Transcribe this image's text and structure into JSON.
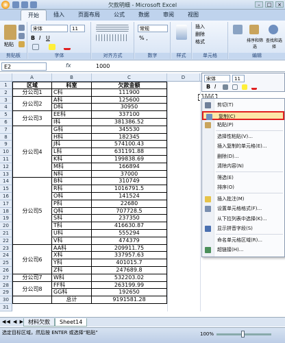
{
  "window": {
    "title": "欠款明细 - Microsoft Excel"
  },
  "ribbon": {
    "tabs": [
      "开始",
      "插入",
      "页面布局",
      "公式",
      "数据",
      "审阅",
      "视图"
    ],
    "active_tab": "开始",
    "groups": [
      "剪贴板",
      "字体",
      "对齐方式",
      "数字",
      "样式",
      "单元格",
      "编辑"
    ],
    "paste_label": "粘贴",
    "font_name": "宋体",
    "font_size": "11",
    "number_format": "常规",
    "percent_label": "% ,",
    "cells_buttons": [
      "插入",
      "删除",
      "格式"
    ],
    "edit_buttons": [
      "排序和筛选",
      "查找和选择"
    ]
  },
  "formula_bar": {
    "name_box": "E2",
    "fx": "fx",
    "value": "1000"
  },
  "columns": [
    "A",
    "B",
    "C",
    "D",
    "E"
  ],
  "table": {
    "headers": [
      "区域",
      "科室",
      "欠款金额"
    ],
    "groups": [
      {
        "region": "分公司1",
        "rows": [
          [
            "C科",
            "111900"
          ]
        ]
      },
      {
        "region": "分公司2",
        "rows": [
          [
            "A科",
            "125600"
          ],
          [
            "D科",
            "30950"
          ]
        ]
      },
      {
        "region": "分公司3",
        "rows": [
          [
            "EE科",
            "337100"
          ],
          [
            "I科",
            "381386.52"
          ]
        ]
      },
      {
        "region": "分公司4",
        "rows": [
          [
            "G科",
            "345530"
          ],
          [
            "H科",
            "182345"
          ],
          [
            "J科",
            "574100.43"
          ],
          [
            "L科",
            "631191.88"
          ],
          [
            "K科",
            "199838.69"
          ],
          [
            "M科",
            "166894"
          ],
          [
            "N科",
            "37000"
          ]
        ]
      },
      {
        "region": "分公司5",
        "rows": [
          [
            "B科",
            "310749"
          ],
          [
            "R科",
            "1016791.5"
          ],
          [
            "O科",
            "141524"
          ],
          [
            "P科",
            "22680"
          ],
          [
            "Q科",
            "707728.5"
          ],
          [
            "S科",
            "237350"
          ],
          [
            "T科",
            "416630.87"
          ],
          [
            "U科",
            "555294"
          ],
          [
            "V科",
            "474379"
          ]
        ]
      },
      {
        "region": "分公司6",
        "rows": [
          [
            "AA科",
            "209911.75"
          ],
          [
            "X科",
            "337957.63"
          ],
          [
            "Y科",
            "401015.7"
          ],
          [
            "Z科",
            "247689.8"
          ]
        ]
      },
      {
        "region": "分公司7",
        "rows": [
          [
            "W科",
            "532203.02"
          ]
        ]
      },
      {
        "region": "分公司8",
        "rows": [
          [
            "FF科",
            "263199.99"
          ],
          [
            "GG科",
            "192650"
          ]
        ]
      }
    ],
    "total_label": "总计",
    "total_value": "9191581.28"
  },
  "row_numbers": [
    "1",
    "2",
    "3",
    "4",
    "5",
    "6",
    "7",
    "8",
    "9",
    "10",
    "11",
    "12",
    "13",
    "14",
    "15",
    "16",
    "17",
    "18",
    "19",
    "20",
    "21",
    "22",
    "23",
    "24",
    "25",
    "26",
    "27",
    "28",
    "29",
    "30",
    "31"
  ],
  "copied_value": "1000",
  "mini_toolbar": {
    "font": "宋体",
    "size": "11"
  },
  "context_menu": {
    "items": [
      {
        "label": "剪切(T)",
        "icon": "scissors-icon"
      },
      {
        "label": "复制(C)",
        "icon": "copy-icon",
        "highlighted": true
      },
      {
        "label": "粘贴(P)",
        "icon": "paste-icon"
      },
      {
        "label": "选择性粘贴(V)...",
        "icon": ""
      },
      {
        "label": "插入复制的单元格(E)...",
        "icon": ""
      },
      {
        "label": "删除(D)...",
        "icon": ""
      },
      {
        "label": "清除内容(N)",
        "icon": ""
      },
      {
        "label": "筛选(E)",
        "icon": ""
      },
      {
        "label": "排序(O)",
        "icon": ""
      },
      {
        "label": "插入批注(M)",
        "icon": "comment-icon"
      },
      {
        "label": "设置单元格格式(F)...",
        "icon": "format-icon"
      },
      {
        "label": "从下拉列表中选择(K)...",
        "icon": ""
      },
      {
        "label": "显示拼音字段(S)",
        "icon": "pinyin-icon"
      },
      {
        "label": "命名单元格区域(R)...",
        "icon": ""
      },
      {
        "label": "超链接(H)...",
        "icon": "link-icon"
      }
    ]
  },
  "sheet_tabs": [
    "材料欠款",
    "Sheet14"
  ],
  "active_sheet": "Sheet14",
  "status": {
    "message": "选定目标区域，然后按 ENTER 或选择“粘贴”",
    "zoom": "100%"
  },
  "colors": {
    "highlight_border": "#e02020",
    "ribbon_bg": "#dbe7f6"
  }
}
